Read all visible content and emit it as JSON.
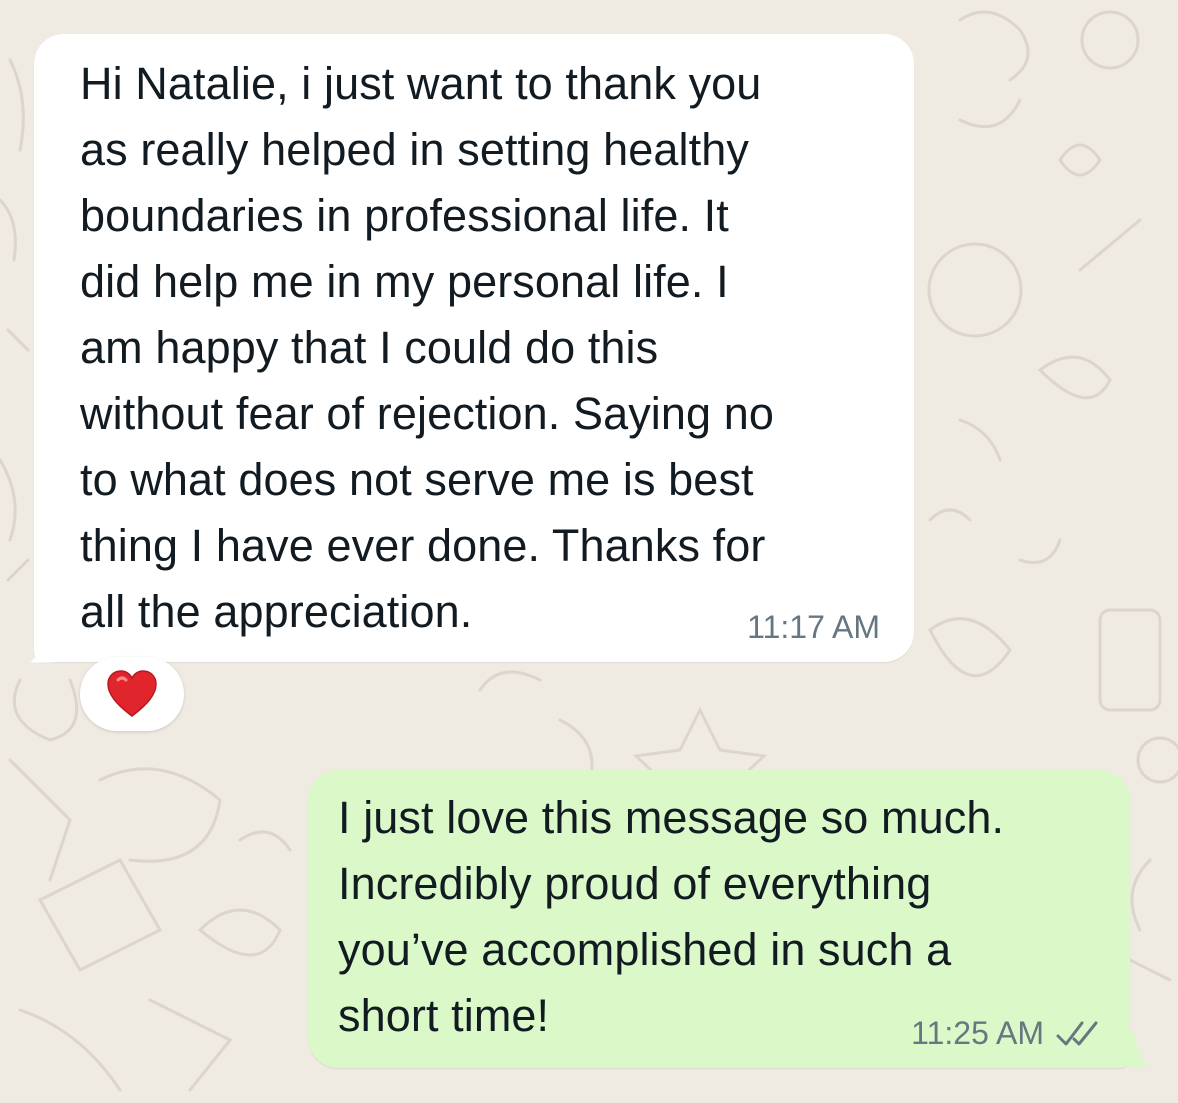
{
  "chat": {
    "incoming_message": {
      "text": "Hi Natalie, i just want to thank you\nas really helped in setting healthy\nboundaries in professional life. It\ndid help me in my personal life. I\nam happy that I could do this\nwithout fear of rejection. Saying no\nto what does not serve me is best\nthing I have ever done. Thanks for\nall the appreciation.",
      "time": "11:17 AM",
      "reaction": "red-heart-icon"
    },
    "outgoing_message": {
      "text": "I just love this message so much.\nIncredibly proud of everything\nyou’ve accomplished in such a\nshort time!",
      "time": "11:25 AM",
      "status_icon": "double-check-icon"
    }
  },
  "colors": {
    "background": "#efeae2",
    "incoming_bubble": "#ffffff",
    "outgoing_bubble": "#dbf8c8",
    "timestamp": "#667781",
    "heart": "#e0252c"
  }
}
